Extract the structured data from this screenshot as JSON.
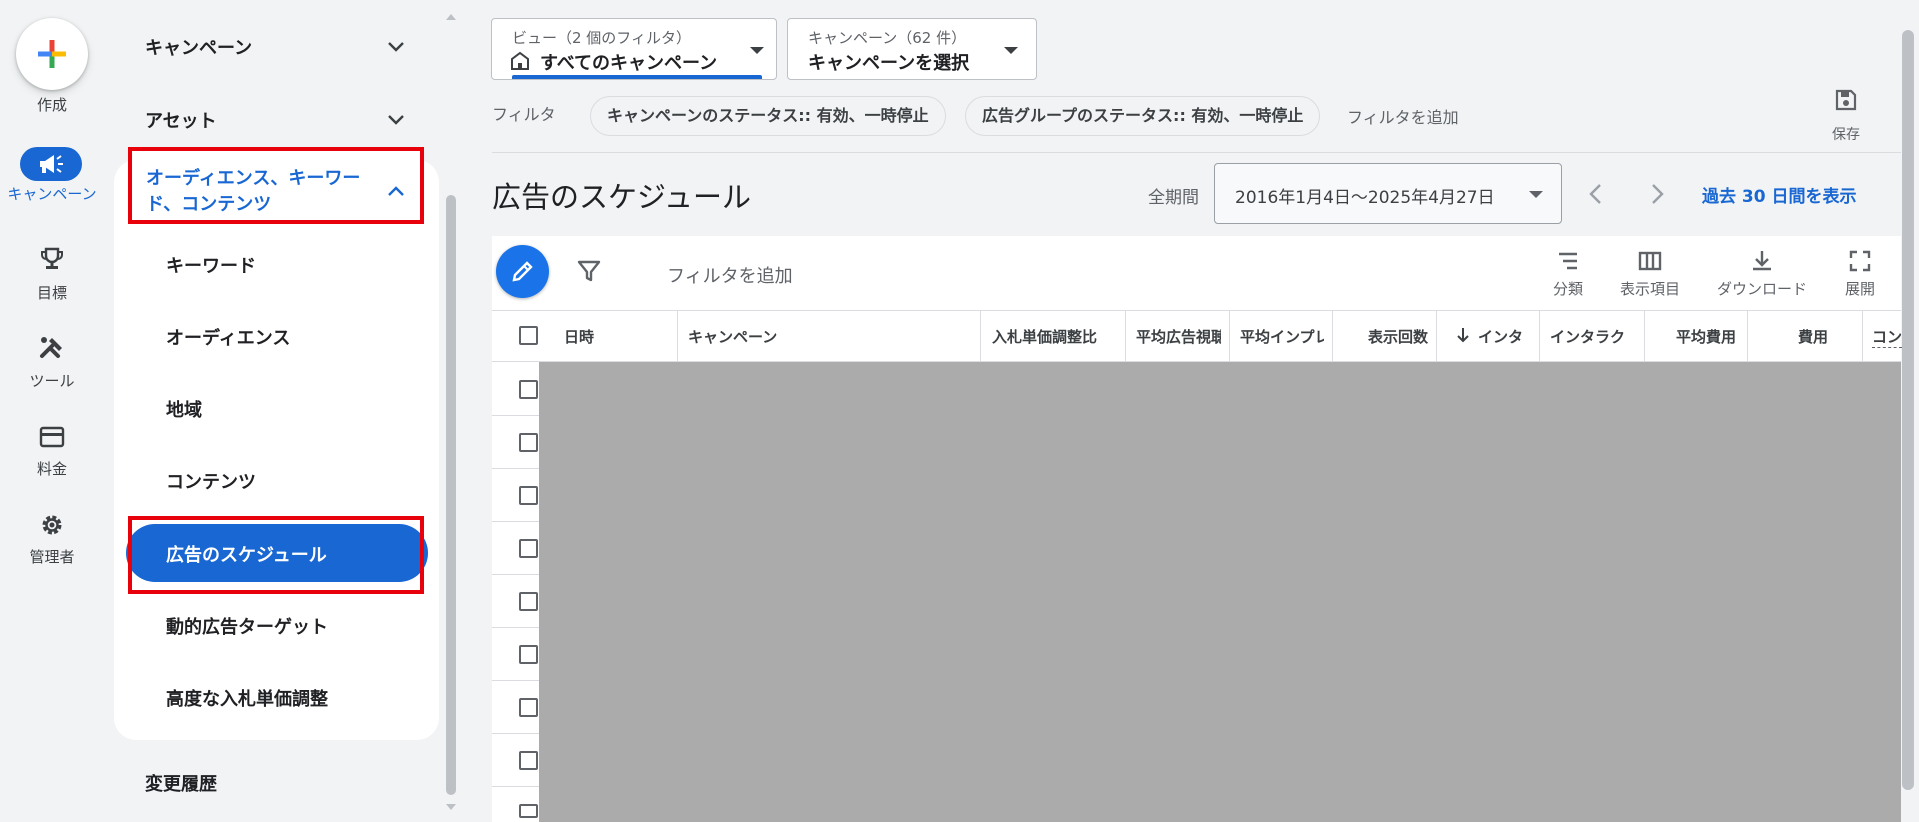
{
  "rail": {
    "create_label": "作成",
    "items": [
      {
        "label": "キャンペーン",
        "icon": "megaphone-icon",
        "active": true
      },
      {
        "label": "目標",
        "icon": "trophy-icon"
      },
      {
        "label": "ツール",
        "icon": "tools-icon"
      },
      {
        "label": "料金",
        "icon": "credit-card-icon"
      },
      {
        "label": "管理者",
        "icon": "gear-icon"
      }
    ]
  },
  "sidebar": {
    "sections": [
      {
        "label": "キャンペーン",
        "expanded": false
      },
      {
        "label": "アセット",
        "expanded": false
      },
      {
        "label": "オーディエンス、キーワード、コンテンツ",
        "expanded": true
      }
    ],
    "sub_items": [
      {
        "label": "キーワード"
      },
      {
        "label": "オーディエンス"
      },
      {
        "label": "地域"
      },
      {
        "label": "コンテンツ"
      },
      {
        "label": "広告のスケジュール",
        "active": true
      },
      {
        "label": "動的広告ターゲット"
      },
      {
        "label": "高度な入札単価調整"
      }
    ],
    "history_label": "変更履歴"
  },
  "view_selector": {
    "small_label": "ビュー（2 個のフィルタ）",
    "value": "すべてのキャンペーン"
  },
  "campaign_selector": {
    "small_label": "キャンペーン（62 件）",
    "value": "キャンペーンを選択"
  },
  "filters": {
    "label": "フィルタ",
    "chips": [
      "キャンペーンのステータス:: 有効、一時停止",
      "広告グループのステータス:: 有効、一時停止"
    ],
    "add_label": "フィルタを追加",
    "save_label": "保存"
  },
  "page": {
    "title": "広告のスケジュール",
    "period_label": "全期間",
    "date_range": "2016年1月4日〜2025年4月27日",
    "last30_label": "過去 30 日間を表示"
  },
  "table_toolbar": {
    "add_filter_label": "フィルタを追加",
    "tools": [
      {
        "label": "分類",
        "icon": "segment-icon"
      },
      {
        "label": "表示項目",
        "icon": "columns-icon"
      },
      {
        "label": "ダウンロード",
        "icon": "download-icon"
      },
      {
        "label": "展開",
        "icon": "fullscreen-icon"
      }
    ]
  },
  "table": {
    "columns": [
      "日時",
      "キャンペーン",
      "入札単価調整比",
      "平均広告視聴",
      "平均インプレ",
      "表示回数",
      "インタ",
      "インタラク",
      "平均費用",
      "費用",
      "コン"
    ],
    "sort_column": "インタ",
    "sort_direction": "descending"
  },
  "colors": {
    "accent": "#1967d2",
    "highlight_box": "#e8000b"
  }
}
